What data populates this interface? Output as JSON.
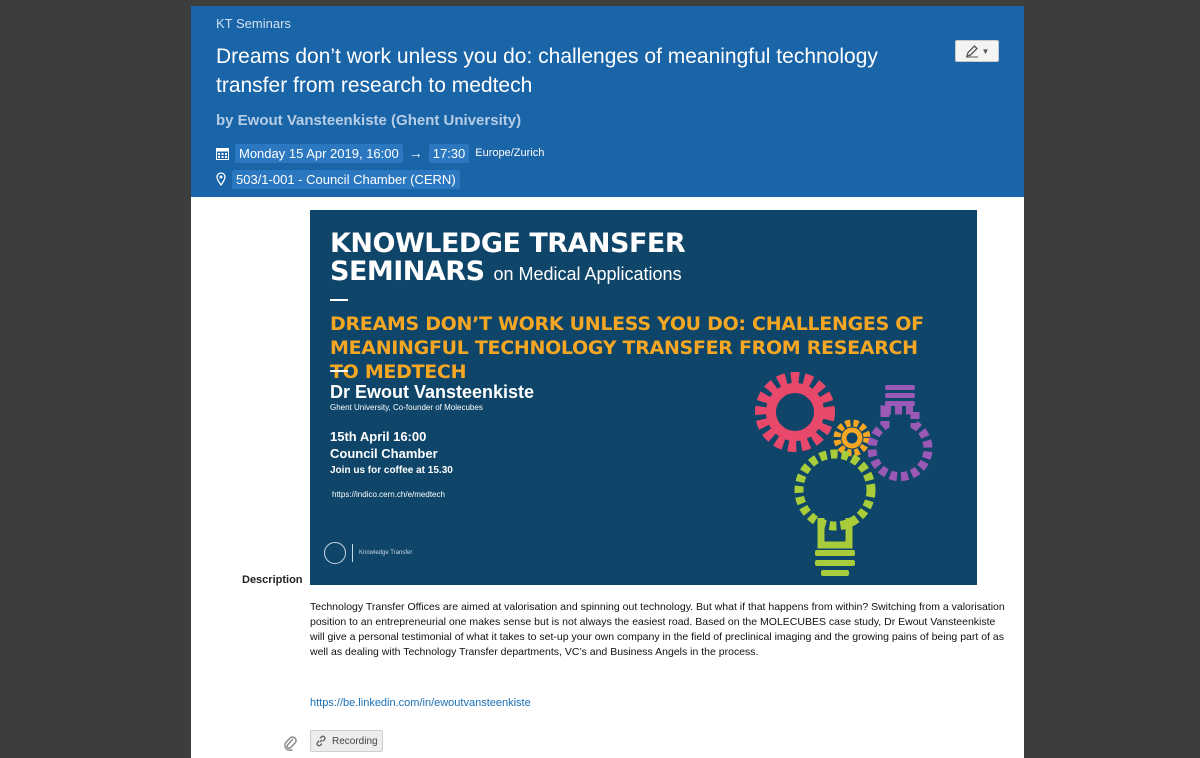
{
  "header": {
    "category": "KT Seminars",
    "title": "Dreams don’t work unless you do: challenges of meaningful technology transfer from research to medtech",
    "speaker": "by Ewout Vansteenkiste (Ghent University)",
    "start": "Monday 15 Apr 2019, 16:00",
    "arrow": "→",
    "end": "17:30",
    "timezone": "Europe/Zurich",
    "location": "503/1-001 - Council Chamber (CERN)",
    "edit_icon": "pencil-icon",
    "bg_color": "#1a64a8"
  },
  "poster": {
    "title_line1": "KNOWLEDGE TRANSFER",
    "title_line2": "SEMINARS",
    "title_sub": "on Medical Applications",
    "topic": "DREAMS DON’T WORK UNLESS YOU DO: CHALLENGES OF MEANINGFUL TECHNOLOGY TRANSFER FROM RESEARCH TO MEDTECH",
    "speaker": "Dr Ewout Vansteenkiste",
    "affiliation": "Ghent University, Co-founder of Molecubes",
    "date": "15th April 16:00",
    "room": "Council Chamber",
    "coffee": "Join us for coffee at 15.30",
    "url": "https://indico.cern.ch/e/medtech",
    "logo_text": "Knowledge Transfer",
    "bg_color": "#0e4569",
    "accent_color": "#f5a623"
  },
  "description": {
    "label": "Description",
    "text": "Technology Transfer Offices are aimed at valorisation and spinning out technology. But what if that happens from within? Switching from a valorisation position to an entrepreneurial one makes sense but is not always the easiest road. Based on the MOLECUBES case study, Dr Ewout Vansteenkiste will give a personal testimonial of what it takes to set-up your own company in the field of preclinical imaging and the growing pains of being part of as well as dealing with Technology Transfer departments, VC’s and Business Angels in the process.",
    "link": "https://be.linkedin.com/in/ewoutvansteenkiste"
  },
  "attachments": {
    "icon": "paperclip-icon",
    "recording_label": "Recording",
    "recording_icon": "link-icon"
  }
}
